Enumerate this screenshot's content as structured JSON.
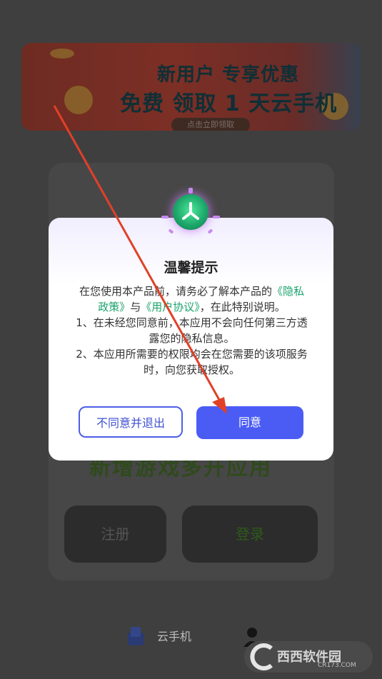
{
  "banner": {
    "line1": "新用户 专享优惠",
    "line2": "免费 领取 1 天云手机",
    "pill": "点击立即领取"
  },
  "background": {
    "heading": "新增游戏多开应用",
    "register_label": "注册",
    "login_label": "登录"
  },
  "bottom_nav": {
    "label": "云手机"
  },
  "dialog": {
    "title": "温馨提示",
    "intro_prefix": "在您使用本产品前，请务必了解本产品的",
    "privacy_link": "《隐私政策》",
    "connector": "与",
    "agreement_link": "《用户协议》",
    "intro_suffix": "，在此特别说明。",
    "item1": "1、在未经您同意前，本应用不会向任何第三方透露您的隐私信息。",
    "item2": "2、本应用所需要的权限均会在您需要的该项服务时，向您获取授权。",
    "decline_label": "不同意并退出",
    "agree_label": "同意"
  },
  "watermark": {
    "text": "西西软件园",
    "sub": "CR173.COM"
  },
  "colors": {
    "accent": "#4b5cf5",
    "link": "#1aa36a",
    "overlay": "#3f3f3f"
  }
}
